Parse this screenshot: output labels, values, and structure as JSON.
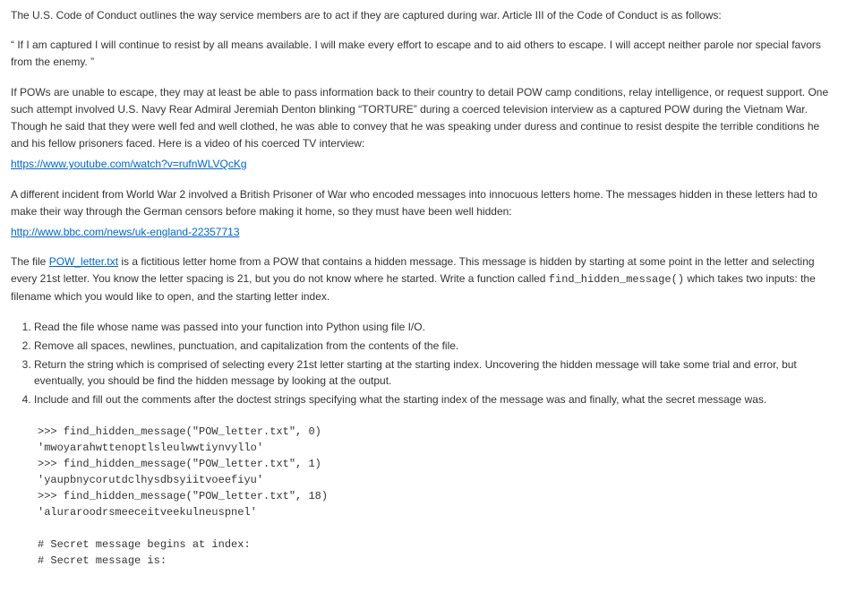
{
  "para1": "The U.S. Code of Conduct outlines the way service members are to act if they are captured during war. Article III of the Code of Conduct is as follows:",
  "quote": "“ If I am captured I will continue to resist by all means available. I will make every effort to escape and to aid others to escape. I will accept neither parole nor special favors from the enemy. ”",
  "para2": "If POWs are unable to escape, they may at least be able to pass information back to their country to detail POW camp conditions, relay intelligence, or request support. One such attempt involved U.S. Navy Rear Admiral Jeremiah Denton blinking “TORTURE” during a coerced television interview as a captured POW during the Vietnam War. Though he said that they were well fed and well clothed, he was able to convey that he was speaking under duress and continue to resist despite the terrible conditions he and his fellow prisoners faced. Here is a video of his coerced TV interview:",
  "link1_text": "https://www.youtube.com/watch?v=rufnWLVQcKg",
  "link1_href": "https://www.youtube.com/watch?v=rufnWLVQcKg",
  "para3": "A different incident from World War 2 involved a British Prisoner of War who encoded messages into innocuous letters home. The messages hidden in these letters had to make their way through the German censors before making it home, so they must have been well hidden:",
  "link2_text": "http://www.bbc.com/news/uk-england-22357713",
  "link2_href": "http://www.bbc.com/news/uk-england-22357713",
  "para4_pre": "The file ",
  "para4_filelink": "POW_letter.txt",
  "para4_post": " is a fictitious letter home from a POW that contains a hidden message. This message is hidden by starting at some point in the letter and selecting every 21st letter. You know the letter spacing is 21, but you do not know where he started. Write a function called ",
  "para4_code": "find_hidden_message()",
  "para4_end": " which takes two inputs: the filename which you would like to open, and the starting letter index.",
  "steps": [
    "Read the file whose name was passed into your function into Python using file I/O.",
    "Remove all spaces, newlines, punctuation, and capitalization from the contents of the file.",
    "Return the string which is comprised of selecting every 21st letter starting at the starting index. Uncovering the hidden message will take some trial and error, but eventually, you should be find the hidden message by looking at the output.",
    "Include and fill out the comments after the doctest strings specifying what the starting index of the message was and finally, what the secret message was."
  ],
  "codeblock": ">>> find_hidden_message(\"POW_letter.txt\", 0)\n'mwoyarahwttenoptlsleulwwtiynvyllo'\n>>> find_hidden_message(\"POW_letter.txt\", 1)\n'yaupbnycorutdclhysdbsyiitvoeefiyu'\n>>> find_hidden_message(\"POW_letter.txt\", 18)\n'aluraroodrsmeeceitveekulneuspnel'\n\n# Secret message begins at index:\n# Secret message is:"
}
